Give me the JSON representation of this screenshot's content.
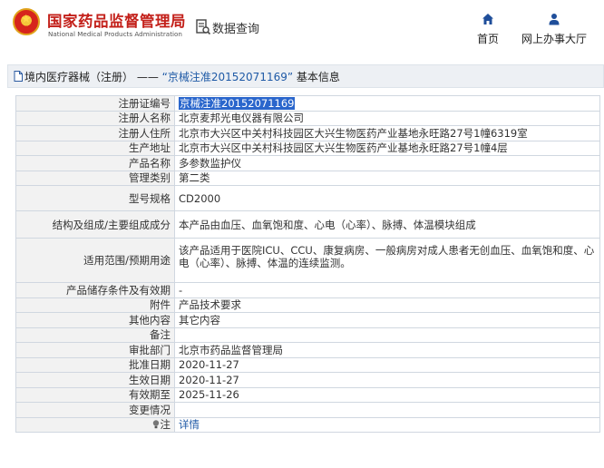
{
  "header": {
    "site_name": "国家药品监督管理局",
    "site_name_en": "National Medical Products Administration",
    "database_query": "数据查询",
    "nav": [
      {
        "label": "首页",
        "icon": "home-icon"
      },
      {
        "label": "网上办事大厅",
        "icon": "user-icon"
      }
    ]
  },
  "title": {
    "prefix": "境内医疗器械（注册）",
    "dash": " —— ",
    "link": "“京械注准20152071169”",
    "suffix": " 基本信息"
  },
  "details": [
    {
      "label": "注册证编号",
      "value": "京械注准20152071169",
      "highlight": true
    },
    {
      "label": "注册人名称",
      "value": "北京麦邦光电仪器有限公司"
    },
    {
      "label": "注册人住所",
      "value": "北京市大兴区中关村科技园区大兴生物医药产业基地永旺路27号1幢6319室"
    },
    {
      "label": "生产地址",
      "value": "北京市大兴区中关村科技园区大兴生物医药产业基地永旺路27号1幢4层"
    },
    {
      "label": "产品名称",
      "value": "多参数监护仪"
    },
    {
      "label": "管理类别",
      "value": "第二类"
    },
    {
      "label": "型号规格",
      "value": "CD2000"
    },
    {
      "label": "结构及组成/主要组成成分",
      "value": "本产品由血压、血氧饱和度、心电（心率）、脉搏、体温模块组成"
    },
    {
      "label": "适用范围/预期用途",
      "value": "该产品适用于医院ICU、CCU、康复病房、一般病房对成人患者无创血压、血氧饱和度、心电（心率）、脉搏、体温的连续监测。"
    },
    {
      "label": "产品储存条件及有效期",
      "value": "-"
    },
    {
      "label": "附件",
      "value": "产品技术要求"
    },
    {
      "label": "其他内容",
      "value": "其它内容"
    },
    {
      "label": "备注",
      "value": ""
    },
    {
      "label": "审批部门",
      "value": "北京市药品监督管理局"
    },
    {
      "label": "批准日期",
      "value": "2020-11-27"
    },
    {
      "label": "生效日期",
      "value": "2020-11-27"
    },
    {
      "label": "有效期至",
      "value": "2025-11-26"
    },
    {
      "label": "变更情况",
      "value": ""
    },
    {
      "label": "注",
      "value": "详情",
      "icon": "lightbulb-icon",
      "link": true
    }
  ],
  "colors": {
    "brand_red": "#c3201a",
    "link_blue": "#1f5aa6",
    "highlight_blue": "#2a66cc"
  }
}
